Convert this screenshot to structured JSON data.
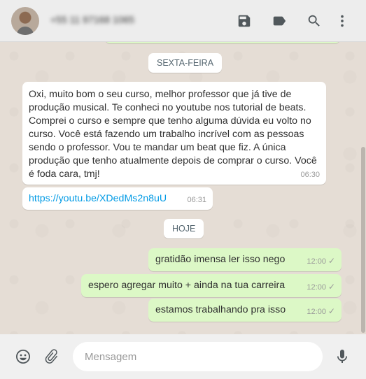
{
  "header": {
    "contact_name": "+55 11 97168 1065"
  },
  "icons": {
    "header": [
      "save-icon",
      "label-icon",
      "search-icon",
      "menu-icon"
    ],
    "footer": [
      "emoji-icon",
      "attach-icon",
      "microphone-icon"
    ]
  },
  "chat": {
    "day_friday": "SEXTA-FEIRA",
    "day_today": "HOJE",
    "incoming": [
      {
        "text": "Oxi, muito bom o seu curso, melhor professor que já tive de produção musical. Te conheci no youtube nos tutorial de beats. Comprei o curso e sempre que tenho alguma dúvida eu volto no curso. Você está fazendo um trabalho incrível com as pessoas sendo o professor. Vou te mandar um beat que fiz. A única produção que tenho atualmente depois de comprar o curso. Você é foda cara, tmj!",
        "time": "06:30"
      },
      {
        "text": "https://youtu.be/XDedMs2n8uU",
        "time": "06:31"
      }
    ],
    "outgoing": [
      {
        "text": "gratidão imensa ler isso nego",
        "time": "12:00",
        "status": "✓"
      },
      {
        "text": "espero agregar muito + ainda na tua carreira",
        "time": "12:00",
        "status": "✓"
      },
      {
        "text": "estamos trabalhando pra isso",
        "time": "12:00",
        "status": "✓"
      }
    ]
  },
  "composer": {
    "placeholder": "Mensagem",
    "value": ""
  },
  "colors": {
    "chat_background": "#e5ddd5",
    "incoming_bubble": "#ffffff",
    "outgoing_bubble": "#dcf8c6",
    "link": "#039be5",
    "header_background": "#ededed"
  }
}
